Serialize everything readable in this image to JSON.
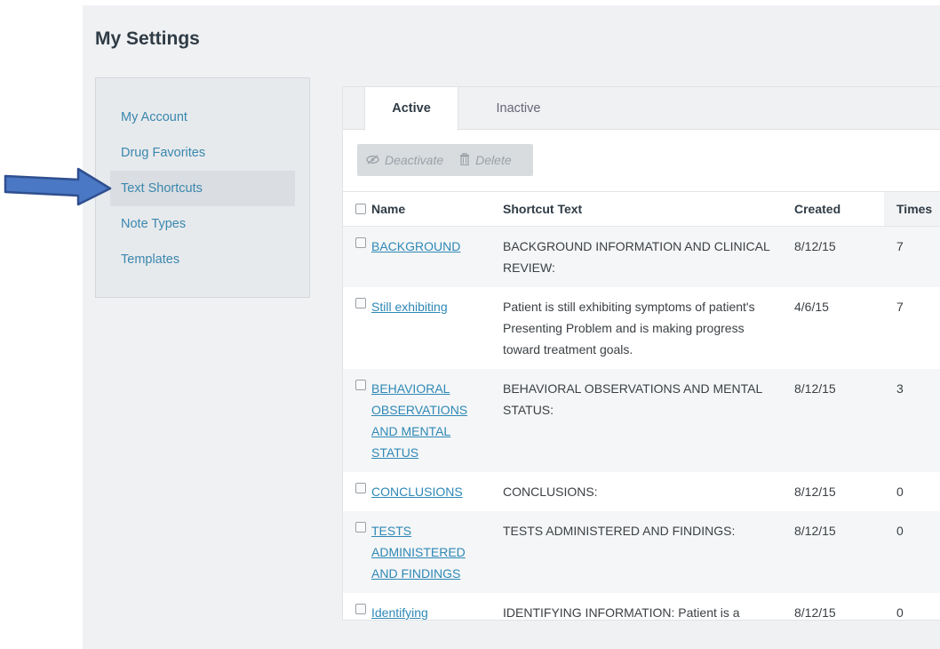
{
  "page": {
    "title": "My Settings"
  },
  "sidebar": {
    "items": [
      {
        "label": "My Account"
      },
      {
        "label": "Drug Favorites"
      },
      {
        "label": "Text Shortcuts",
        "selected": true
      },
      {
        "label": "Note Types"
      },
      {
        "label": "Templates"
      }
    ]
  },
  "tabs": [
    {
      "label": "Active",
      "active": true
    },
    {
      "label": "Inactive"
    }
  ],
  "toolbar": {
    "deactivate_label": "Deactivate",
    "delete_label": "Delete"
  },
  "table": {
    "headers": {
      "name": "Name",
      "shortcut": "Shortcut Text",
      "created": "Created",
      "times": "Times"
    },
    "rows": [
      {
        "name": "BACKGROUND",
        "shortcut": "BACKGROUND INFORMATION AND CLINICAL REVIEW:",
        "created": "8/12/15",
        "times": "7"
      },
      {
        "name": "Still exhibiting",
        "shortcut": "Patient is still exhibiting symptoms of patient's Presenting Problem and is making progress toward treatment goals.",
        "created": "4/6/15",
        "times": "7"
      },
      {
        "name": "BEHAVIORAL OBSERVATIONS AND MENTAL STATUS",
        "shortcut": "BEHAVIORAL OBSERVATIONS AND MENTAL STATUS:",
        "created": "8/12/15",
        "times": "3"
      },
      {
        "name": "CONCLUSIONS",
        "shortcut": "CONCLUSIONS:",
        "created": "8/12/15",
        "times": "0"
      },
      {
        "name": "TESTS ADMINISTERED AND FINDINGS",
        "shortcut": "TESTS ADMINISTERED AND FINDINGS:",
        "created": "8/12/15",
        "times": "0"
      },
      {
        "name": "Identifying Information",
        "shortcut": "IDENTIFYING INFORMATION: Patient is a",
        "created": "8/12/15",
        "times": "0"
      }
    ]
  },
  "colors": {
    "link": "#2e88b6",
    "sidebar_link": "#3a87ad",
    "arrow": "#4472c4"
  },
  "icons": {
    "deactivate": "eye-slash-icon",
    "delete": "trash-icon",
    "annotation": "arrow-right-icon"
  }
}
